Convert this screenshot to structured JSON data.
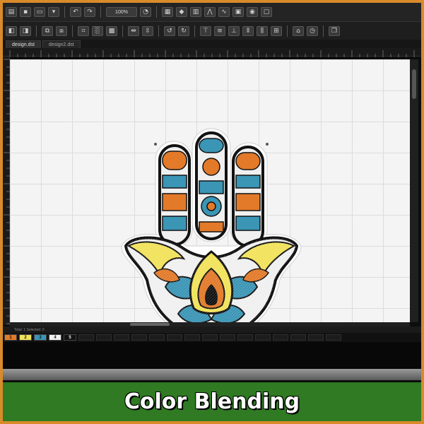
{
  "toolbar": {
    "zoom_label": "100%",
    "icons_row1": [
      "folder-open-icon",
      "save-icon",
      "print-icon",
      "stitch-icon",
      "undo-icon",
      "redo-icon",
      "rotate-icon",
      "select-icon",
      "shape-icon",
      "text-icon",
      "node-icon",
      "wave-icon",
      "monogram-icon",
      "color-icon",
      "outline-icon"
    ],
    "icons_row2": [
      "align-left-icon",
      "align-right-icon",
      "group-icon",
      "ungroup-icon",
      "crop-icon",
      "pattern-icon",
      "fill-icon",
      "mirror-h-icon",
      "mirror-v-icon",
      "rotate-left-icon",
      "rotate-right-icon",
      "align-top-icon",
      "align-middle-icon",
      "align-bottom-icon",
      "distribute-h-icon",
      "distribute-v-icon",
      "order-icon",
      "lock-icon",
      "arrange-icon",
      "copy-icon"
    ]
  },
  "tabs": [
    {
      "label": "design.dst",
      "active": true
    },
    {
      "label": "design2.dst",
      "active": false
    }
  ],
  "status": {
    "text": "Total: 1  Selected: 0"
  },
  "palette": [
    {
      "num": "1",
      "color": "#e27a2a"
    },
    {
      "num": "2",
      "color": "#f1e25a"
    },
    {
      "num": "3",
      "color": "#3b95b5"
    },
    {
      "num": "4",
      "color": "#f0f0f0"
    },
    {
      "num": "5",
      "color": "#121212"
    }
  ],
  "banner": {
    "title": "Color Blending"
  },
  "colors": {
    "accent_orange": "#e27a2a",
    "accent_yellow": "#f1e25a",
    "accent_blue": "#3b95b5",
    "banner_green": "#2f7a22",
    "frame_orange": "#d98a2b"
  }
}
